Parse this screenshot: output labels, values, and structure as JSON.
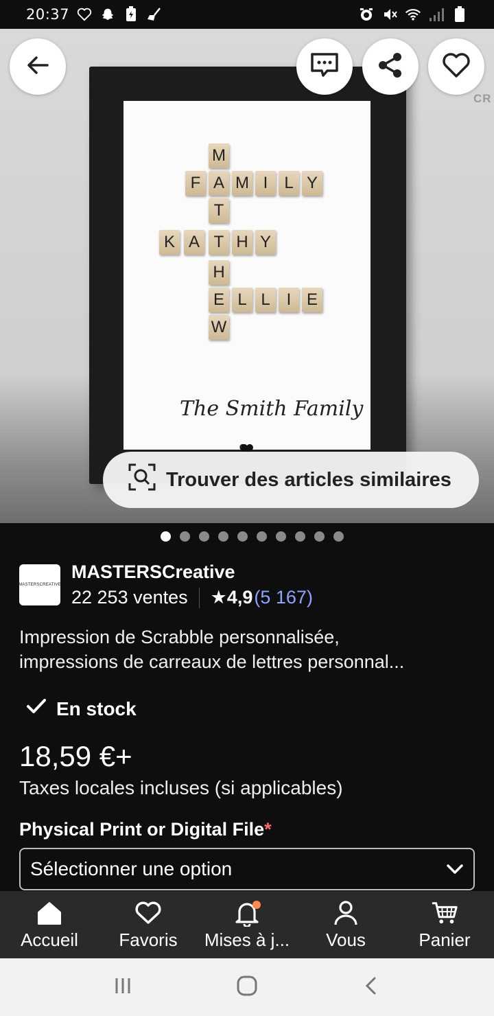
{
  "status_bar": {
    "time": "20:37",
    "left_icons": [
      "heart-outline-icon",
      "snapchat-icon",
      "battery-app-icon",
      "broom-icon"
    ],
    "right_icons": [
      "alarm-icon",
      "mute-icon",
      "wifi-icon",
      "signal-icon",
      "battery-icon"
    ]
  },
  "hero": {
    "tiles": {
      "word_family": "FAMILY",
      "word_kathy": "KATHY",
      "word_ellie": "ELLIE",
      "word_mathew": "MATHEW"
    },
    "script_text": "The Smith Family",
    "watermark": "CR",
    "similar_button": "Trouver des articles similaires"
  },
  "carousel": {
    "count": 10,
    "active_index": 0
  },
  "shop": {
    "name": "MASTERSCreative",
    "logo_text": "MASTERSCREATIVE",
    "sales": "22 253 ventes",
    "rating": "★4,9",
    "reviews": "(5 167)"
  },
  "listing": {
    "title_line1": "Impression de Scrabble personnalisée,",
    "title_line2": "impressions de carreaux de lettres personnal...",
    "stock": "En stock",
    "price": "18,59 €+",
    "tax_note": "Taxes locales incluses (si applicables)",
    "option_label": "Physical Print or Digital File",
    "option_required": "*",
    "select_placeholder": "Sélectionner une option"
  },
  "bottom_nav": {
    "items": [
      {
        "label": "Accueil",
        "icon": "home-icon"
      },
      {
        "label": "Favoris",
        "icon": "heart-icon"
      },
      {
        "label": "Mises à j...",
        "icon": "bell-icon"
      },
      {
        "label": "Vous",
        "icon": "user-icon"
      },
      {
        "label": "Panier",
        "icon": "cart-icon"
      }
    ]
  },
  "colors": {
    "background": "#0e0e0e",
    "nav_background": "#2a2a2a",
    "link": "#8fa3ff",
    "notification": "#ff8a4c",
    "required": "#ff6b6b"
  }
}
